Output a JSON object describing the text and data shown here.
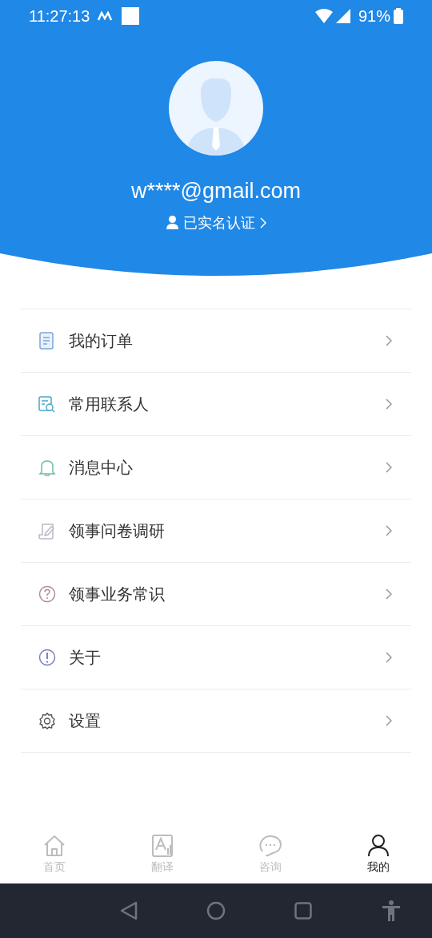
{
  "status_bar": {
    "time": "11:27:13",
    "battery": "91%"
  },
  "profile": {
    "email": "w****@gmail.com",
    "verification": "已实名认证"
  },
  "menu": [
    {
      "kind": "order",
      "label": "我的订单"
    },
    {
      "kind": "contacts",
      "label": "常用联系人"
    },
    {
      "kind": "bell",
      "label": "消息中心"
    },
    {
      "kind": "survey",
      "label": "领事问卷调研"
    },
    {
      "kind": "question",
      "label": "领事业务常识"
    },
    {
      "kind": "info",
      "label": "关于"
    },
    {
      "kind": "gear",
      "label": "设置"
    }
  ],
  "tabs": [
    {
      "kind": "home",
      "label": "首页",
      "selected": false
    },
    {
      "kind": "translate",
      "label": "翻译",
      "selected": false
    },
    {
      "kind": "chat",
      "label": "咨询",
      "selected": false
    },
    {
      "kind": "user",
      "label": "我的",
      "selected": true
    }
  ]
}
